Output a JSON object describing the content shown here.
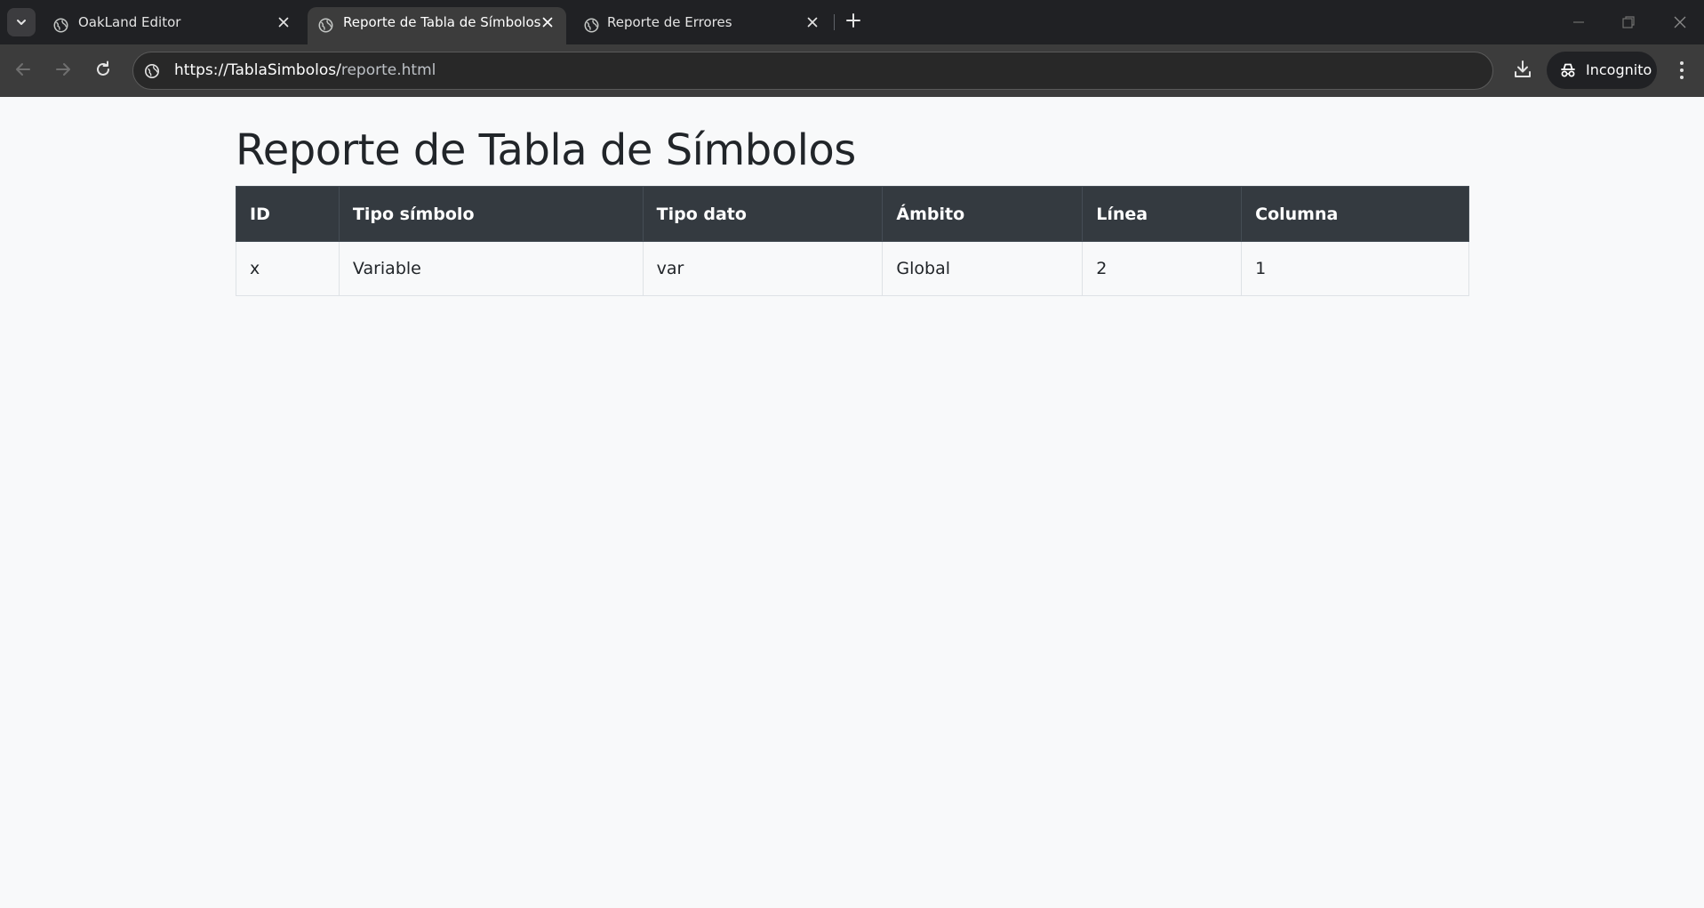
{
  "browser": {
    "tabs": [
      {
        "title": "OakLand Editor",
        "active": false,
        "icon": "globe-icon"
      },
      {
        "title": "Reporte de Tabla de Símbolos",
        "active": true,
        "icon": "globe-icon"
      },
      {
        "title": "Reporte de Errores",
        "active": false,
        "icon": "globe-icon"
      }
    ],
    "url_host": "https://TablaSimbolos/",
    "url_path": "reporte.html",
    "incognito_label": "Incognito"
  },
  "page": {
    "title": "Reporte de Tabla de Símbolos",
    "table": {
      "headers": [
        "ID",
        "Tipo símbolo",
        "Tipo dato",
        "Ámbito",
        "Línea",
        "Columna"
      ],
      "rows": [
        [
          "x",
          "Variable",
          "var",
          "Global",
          "2",
          "1"
        ]
      ]
    }
  },
  "colors": {
    "tabstrip_bg": "#202124",
    "toolbar_bg": "#3c3c3c",
    "table_header_bg": "#343a40",
    "page_bg": "#f8f9fa",
    "text": "#212529"
  }
}
